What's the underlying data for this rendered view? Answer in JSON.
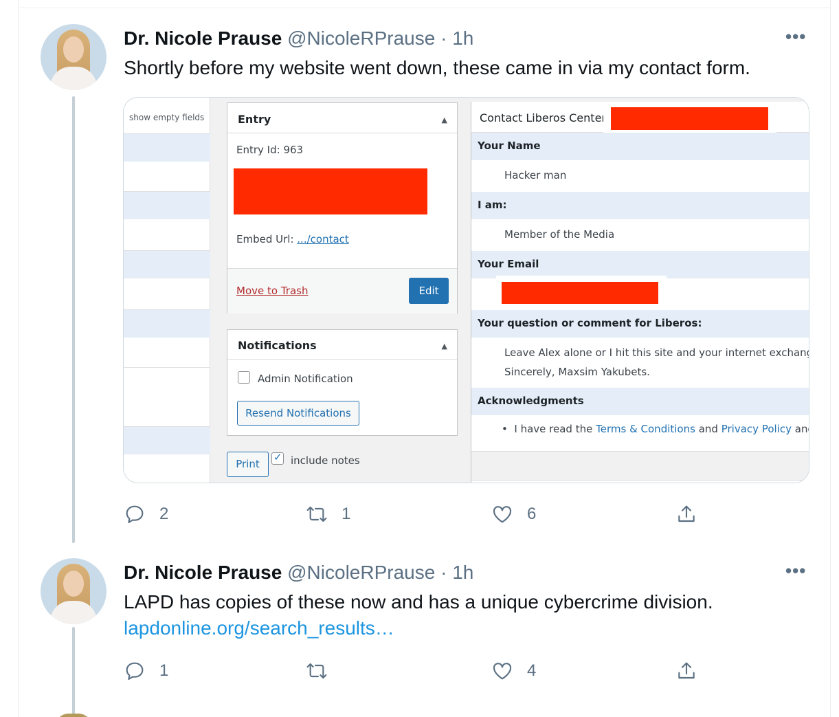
{
  "tweets": [
    {
      "name": "Dr. Nicole Prause",
      "handle": "@NicoleRPrause",
      "separator": "·",
      "time": "1h",
      "text": "Shortly before my website went down, these came in via my contact form.",
      "counts": {
        "replies": "2",
        "retweets": "1",
        "likes": "6"
      }
    },
    {
      "name": "Dr. Nicole Prause",
      "handle": "@NicoleRPrause",
      "separator": "·",
      "time": "1h",
      "text": "LAPD has copies of these now and has a unique cybercrime division.",
      "link": "lapdonline.org/search_results…",
      "counts": {
        "replies": "1",
        "retweets": "",
        "likes": "4"
      }
    }
  ],
  "media": {
    "left_header": "show empty fields",
    "entry_box": {
      "title": "Entry",
      "entry_id": "Entry Id: 963",
      "embed_label": "Embed Url:",
      "embed_link": ".../contact",
      "trash": "Move to Trash",
      "edit": "Edit"
    },
    "notifications_box": {
      "title": "Notifications",
      "admin_notification": "Admin Notification",
      "resend": "Resend Notifications"
    },
    "print": "Print",
    "include_notes": "include notes",
    "form": {
      "title": "Contact Liberos Center",
      "fields": [
        {
          "label": "Your Name",
          "value": "Hacker man"
        },
        {
          "label": "I am:",
          "value": "Member of the Media"
        },
        {
          "label": "Your Email",
          "value": ""
        },
        {
          "label": "Your question or comment for Liberos:",
          "value": "Leave Alex alone or I hit this site and your internet exchange p",
          "value2": "Sincerely, Maxsim Yakubets."
        },
        {
          "label": "Acknowledgments"
        }
      ],
      "ack": {
        "bullet": "•",
        "pre": "I have read the",
        "terms": "Terms & Conditions",
        "and": "and",
        "privacy": "Privacy Policy",
        "post": "and a"
      }
    }
  },
  "icons": {
    "more": "more-icon",
    "reply": "reply-icon",
    "retweet": "retweet-icon",
    "like": "like-icon",
    "share": "share-icon"
  },
  "colors": {
    "link_blue": "#1b95e0",
    "muted": "#5b7083",
    "redaction": "#ff2a00",
    "wp_blue": "#2271b1"
  }
}
